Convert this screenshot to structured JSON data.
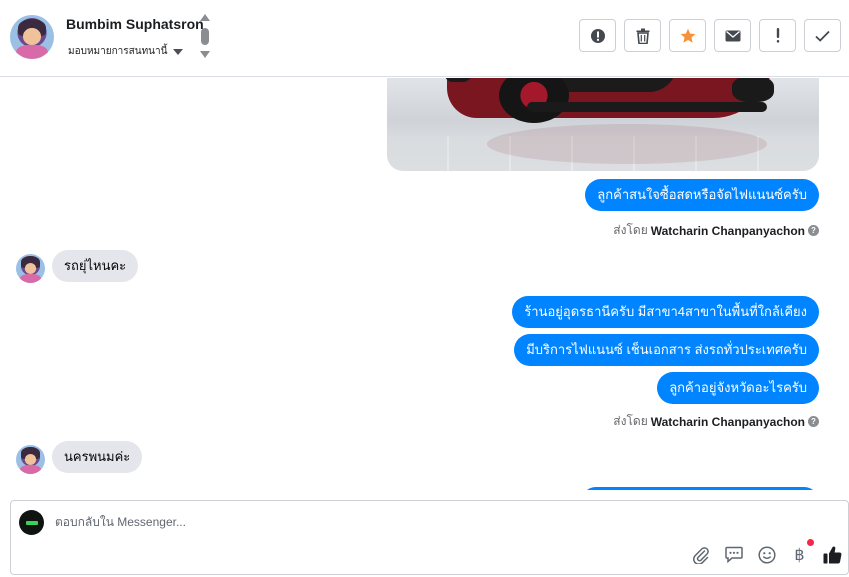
{
  "header": {
    "contact_name": "Bumbim Suphatsron",
    "assign_label": "มอบหมายการสนทนานี้",
    "actions": [
      {
        "icon": "alert-circle-icon",
        "label": "mark as spam"
      },
      {
        "icon": "trash-icon",
        "label": "delete"
      },
      {
        "icon": "star-icon",
        "label": "star"
      },
      {
        "icon": "envelope-icon",
        "label": "mark unread"
      },
      {
        "icon": "exclamation-icon",
        "label": "follow up"
      },
      {
        "icon": "check-icon",
        "label": "done"
      }
    ]
  },
  "messages": [
    {
      "direction": "out",
      "text": "ลูกค้าสนใจซื้อสดหรือจัดไฟแนนซ์ครับ"
    },
    {
      "sent_by_prefix": "ส่งโดย",
      "agent": "Watcharin Chanpanyachon"
    },
    {
      "direction": "in",
      "text": "รถยุ่ไหนคะ"
    },
    {
      "direction": "out",
      "text": "ร้านอยู่อุดรธานีครับ มีสาขา4สาขาในพื้นที่ใกล้เคียง"
    },
    {
      "direction": "out",
      "text": "มีบริการไฟแนนซ์ เช็นเอกสาร ส่งรถทั่วประเทศครับ"
    },
    {
      "direction": "out",
      "text": "ลูกค้าอยู่จังหวัดอะไรครับ"
    },
    {
      "sent_by_prefix": "ส่งโดย",
      "agent": "Watcharin Chanpanyachon"
    },
    {
      "direction": "in",
      "text": "นครพนมค่ะ"
    }
  ],
  "composer": {
    "placeholder": "ตอบกลับใน Messenger...",
    "tools": [
      "paperclip-icon",
      "chat-bubble-icon",
      "smiley-icon",
      "baht-icon",
      "thumbs-up-icon"
    ],
    "baht_symbol": "฿"
  },
  "colors": {
    "outgoing_bubble": "#0084ff",
    "incoming_bubble": "#e4e6eb",
    "star_active": "#f7923a",
    "notification_dot": "#f02849"
  }
}
